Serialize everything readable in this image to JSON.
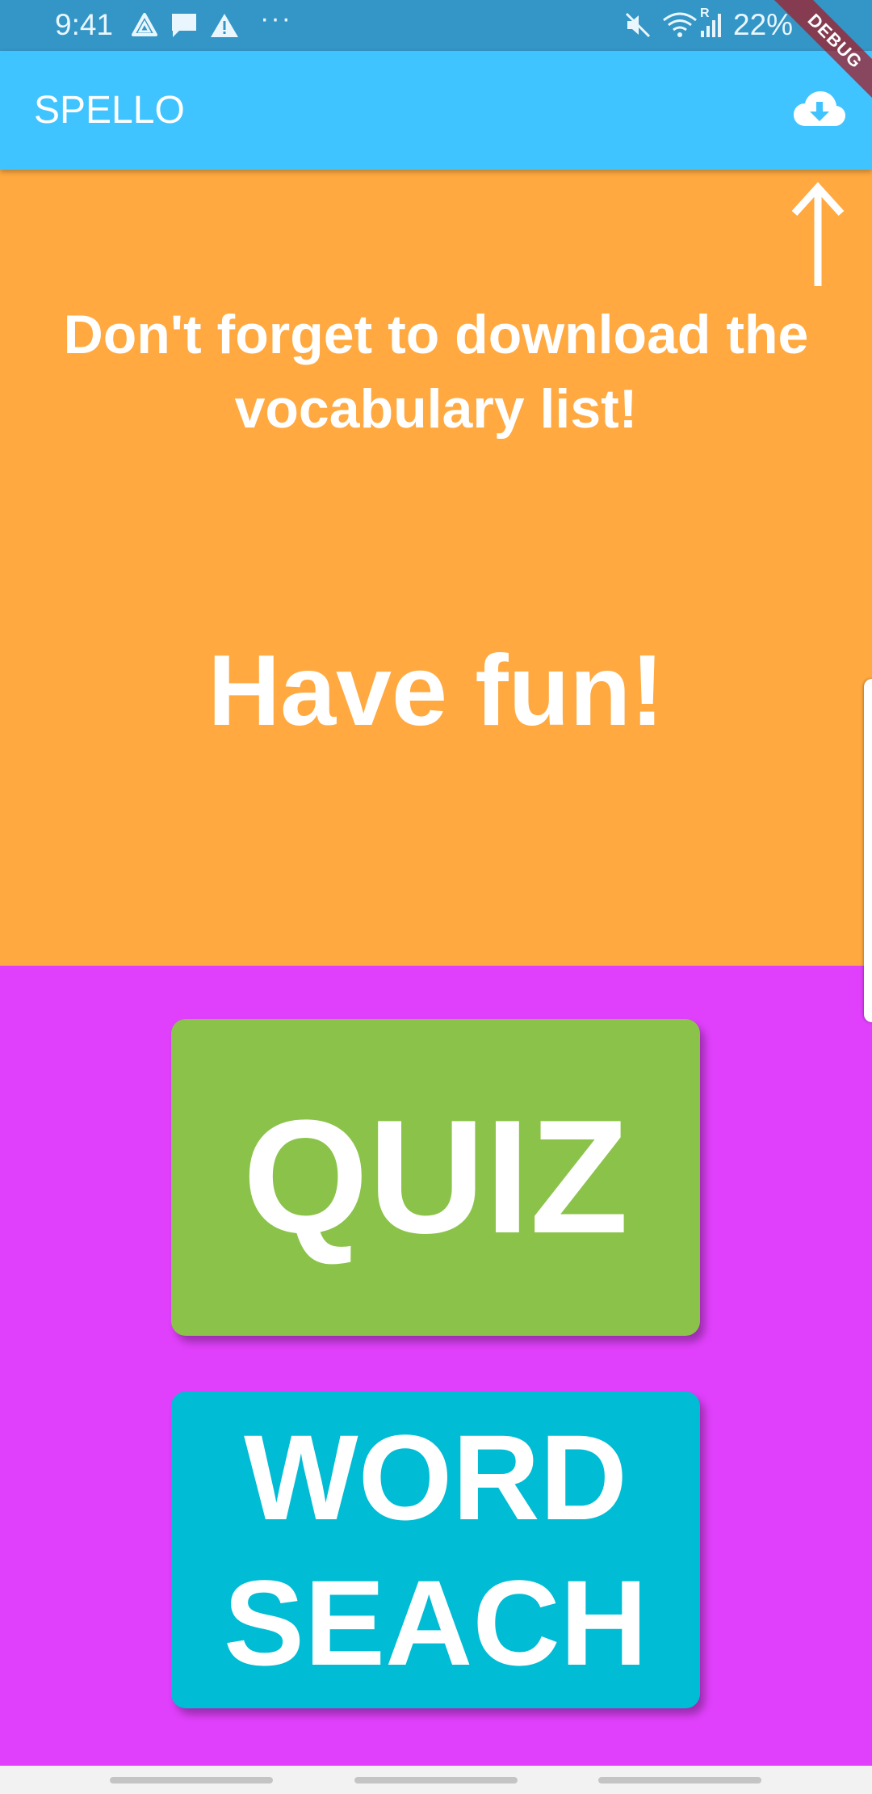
{
  "status_bar": {
    "time": "9:41",
    "icons_left": [
      "drive-icon",
      "message-icon",
      "warning-icon"
    ],
    "more": "···",
    "icons_right": [
      "mute-icon",
      "wifi-icon",
      "signal-icon"
    ],
    "wifi_badge": "R",
    "battery": "22%"
  },
  "debug_banner": "DEBUG",
  "app_bar": {
    "title": "SPELLO",
    "action_icon": "cloud-download-icon"
  },
  "banner": {
    "hint_arrow_icon": "arrow-up-icon",
    "reminder": "Don't forget to download the vocabulary list!",
    "tagline": "Have fun!"
  },
  "actions": {
    "quiz_label": "QUIZ",
    "word_search_line1": "WORD",
    "word_search_line2": "SEACH"
  },
  "colors": {
    "status_bar": "#3496c6",
    "app_bar": "#40c4ff",
    "orange_panel": "#ffa940",
    "magenta_panel": "#e040fb",
    "quiz_button": "#8bc34a",
    "word_search_button": "#00bcd4"
  }
}
